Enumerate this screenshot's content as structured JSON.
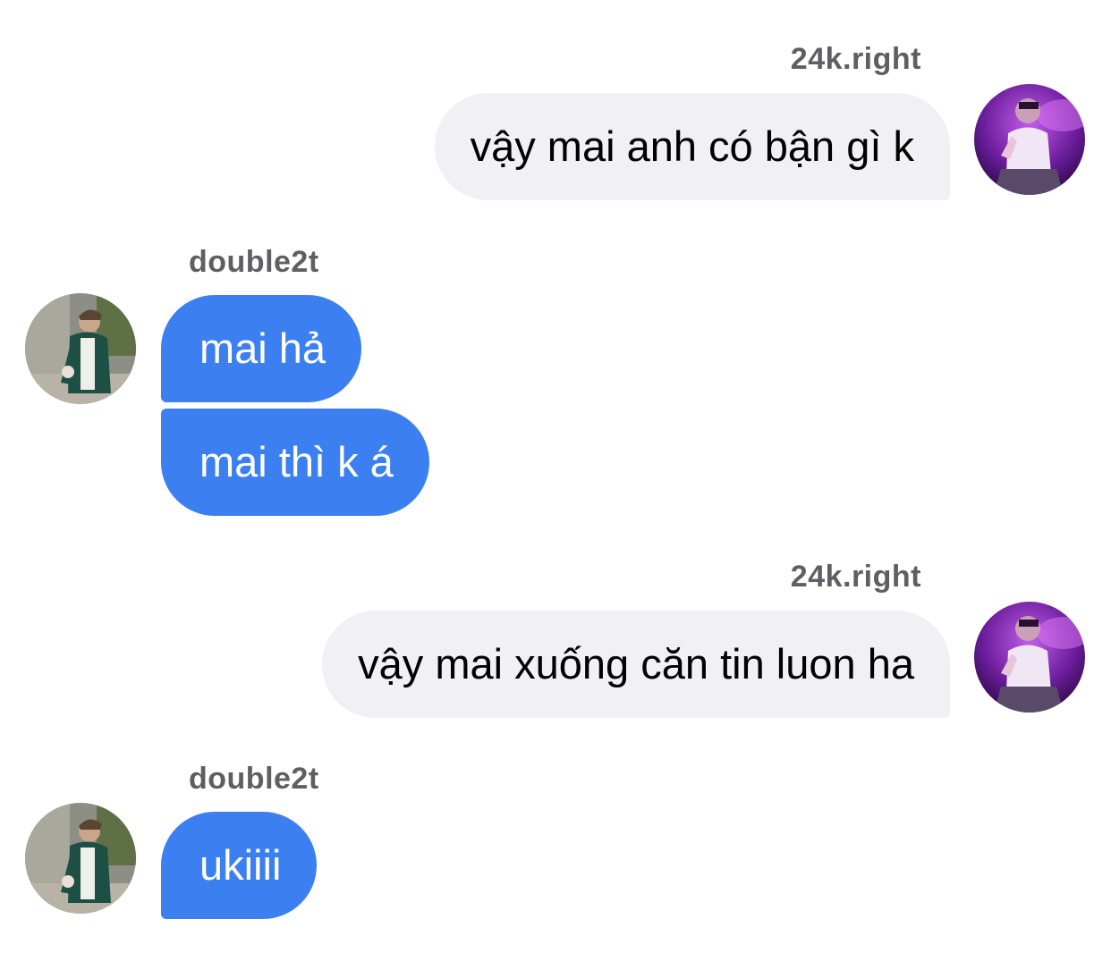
{
  "conversation": [
    {
      "sender": "24k.right",
      "side": "right",
      "messages": [
        "vậy mai anh có bận gì k"
      ]
    },
    {
      "sender": "double2t",
      "side": "left",
      "messages": [
        "mai hả",
        "mai thì k á"
      ]
    },
    {
      "sender": "24k.right",
      "side": "right",
      "messages": [
        "vậy mai xuống căn tin luon ha"
      ]
    },
    {
      "sender": "double2t",
      "side": "left",
      "messages": [
        "ukiiii"
      ]
    }
  ],
  "colors": {
    "outgoing_bubble": "#f0f0f5",
    "incoming_bubble": "#3b7ff0",
    "sender_name": "#5f5f63"
  },
  "avatars": {
    "24k.right": "avatar-purple-photo",
    "double2t": "avatar-green-jacket-photo"
  }
}
